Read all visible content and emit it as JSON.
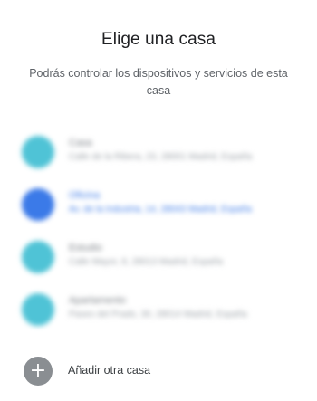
{
  "header": {
    "title": "Elige una casa",
    "subtitle": "Podrás controlar los dispositivos y servicios de esta casa"
  },
  "homes": [
    {
      "name": "Casa",
      "address": "Calle de la Ribera, 23, 28001 Madrid, España",
      "icon": "home-avatar",
      "color": "#4fc3d6",
      "selected": false
    },
    {
      "name": "Oficina",
      "address": "Av. de la Industria, 14, 28043 Madrid, España",
      "icon": "home-avatar",
      "color": "#3b7ae8",
      "selected": true
    },
    {
      "name": "Estudio",
      "address": "Calle Mayor, 8, 28013 Madrid, España",
      "icon": "home-avatar",
      "color": "#4fc3d6",
      "selected": false
    },
    {
      "name": "Apartamento",
      "address": "Paseo del Prado, 30, 28014 Madrid, España",
      "icon": "home-avatar",
      "color": "#4fc3d6",
      "selected": false
    }
  ],
  "add_home": {
    "label": "Añadir otra casa",
    "icon": "plus-icon"
  }
}
